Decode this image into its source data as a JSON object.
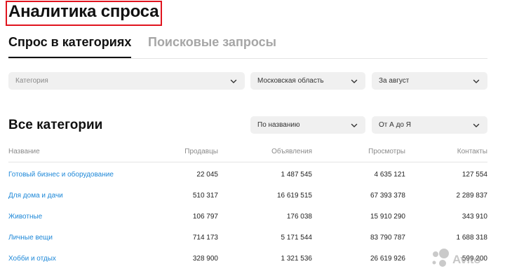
{
  "header": {
    "title": "Аналитика спроса"
  },
  "tabs": [
    {
      "label": "Спрос в категориях",
      "active": true
    },
    {
      "label": "Поисковые запросы",
      "active": false
    }
  ],
  "filters": {
    "category_placeholder": "Категория",
    "region": "Московская область",
    "period": "За август"
  },
  "section": {
    "title": "Все категории",
    "sort_by": "По названию",
    "sort_order": "От А до Я"
  },
  "table": {
    "columns": [
      "Название",
      "Продавцы",
      "Объявления",
      "Просмотры",
      "Контакты"
    ],
    "rows": [
      [
        "Готовый бизнес и оборудование",
        "22 045",
        "1 487 545",
        "4 635 121",
        "127 554"
      ],
      [
        "Для дома и дачи",
        "510 317",
        "16 619 515",
        "67 393 378",
        "2 289 837"
      ],
      [
        "Животные",
        "106 797",
        "176 038",
        "15 910 290",
        "343 910"
      ],
      [
        "Личные вещи",
        "714 173",
        "5 171 544",
        "83 790 787",
        "1 688 318"
      ],
      [
        "Хобби и отдых",
        "328 900",
        "1 321 536",
        "26 619 926",
        "599 200"
      ]
    ]
  },
  "watermark": {
    "text": "Avito"
  },
  "colors": {
    "highlight_border": "#e0141e",
    "link": "#1e88d8",
    "muted": "#a6a6a6",
    "select_bg": "#f0f0f0"
  }
}
